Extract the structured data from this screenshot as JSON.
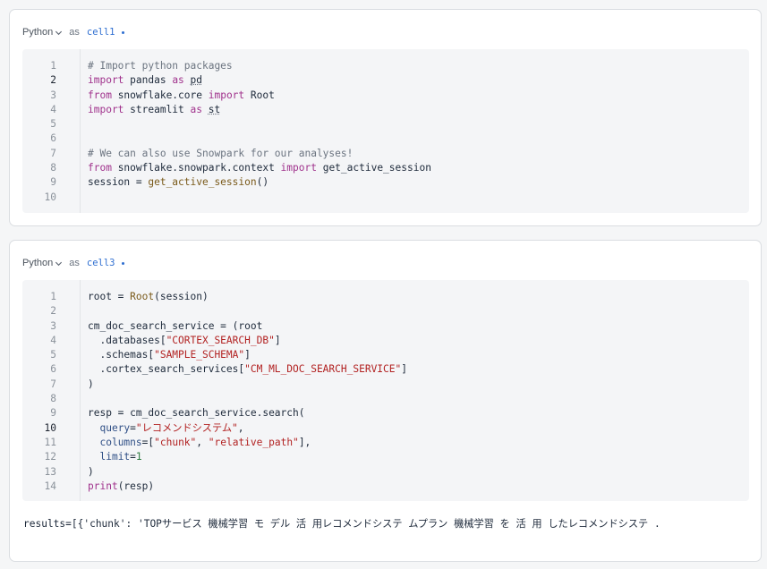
{
  "cells": [
    {
      "language": "Python",
      "as_label": "as",
      "name": "cell1",
      "active_line": 2,
      "lines": [
        "# Import python packages",
        "import pandas as pd",
        "from snowflake.core import Root",
        "import streamlit as st",
        "",
        "",
        "# We can also use Snowpark for our analyses!",
        "from snowflake.snowpark.context import get_active_session",
        "session = get_active_session()",
        ""
      ]
    },
    {
      "language": "Python",
      "as_label": "as",
      "name": "cell3",
      "active_line": 10,
      "lines": [
        "root = Root(session)",
        "",
        "cm_doc_search_service = (root",
        "  .databases[\"CORTEX_SEARCH_DB\"]",
        "  .schemas[\"SAMPLE_SCHEMA\"]",
        "  .cortex_search_services[\"CM_ML_DOC_SEARCH_SERVICE\"]",
        ")",
        "",
        "resp = cm_doc_search_service.search(",
        "  query=\"レコメンドシステム\",",
        "  columns=[\"chunk\", \"relative_path\"],",
        "  limit=1",
        ")",
        "print(resp)"
      ],
      "output": "results=[{'chunk': 'TOPサービス 機械学習 モ デル 活 用レコメンドシステ ムプラン 機械学習 を 活 用 したレコメンドシステ ."
    }
  ],
  "colors": {
    "keyword": "#a0328c",
    "comment": "#6b7480",
    "string": "#b22222",
    "function": "#7a5a1a",
    "accent": "#2f6fd1"
  }
}
